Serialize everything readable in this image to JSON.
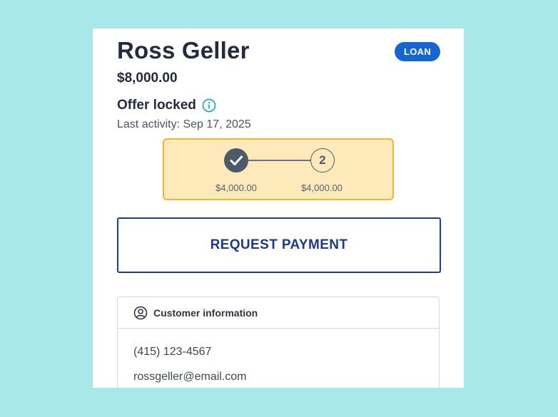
{
  "customer": {
    "name": "Ross Geller",
    "amount": "$8,000.00",
    "type_badge": "LOAN"
  },
  "offer": {
    "status": "Offer locked",
    "last_activity": "Last activity: Sep 17, 2025"
  },
  "progress": {
    "steps": [
      {
        "state": "complete",
        "amount": "$4,000.00"
      },
      {
        "state": "pending",
        "label": "2",
        "amount": "$4,000.00"
      }
    ]
  },
  "actions": {
    "request_payment": "REQUEST PAYMENT"
  },
  "customer_info": {
    "title": "Customer information",
    "phone": "(415) 123-4567",
    "email": "rossgeller@email.com"
  },
  "colors": {
    "background": "#a8e8e8",
    "badge": "#1565d2",
    "accent_info": "#19aebd",
    "progress_fill": "#fde9b9",
    "progress_border": "#f5b42d",
    "button_text": "#1a3b8a"
  },
  "icons": {
    "info": "info-icon",
    "checkmark": "check-icon",
    "person": "person-circle-icon"
  }
}
